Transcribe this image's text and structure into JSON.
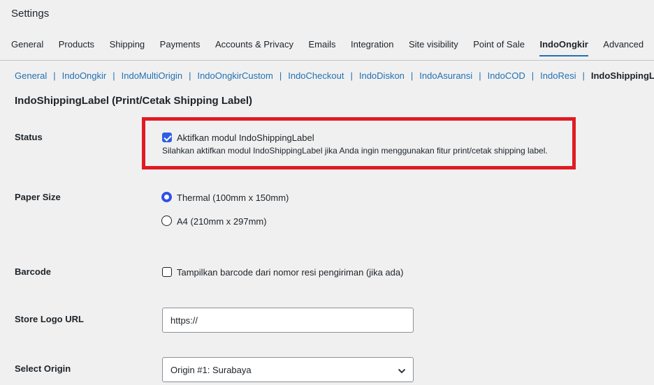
{
  "page": {
    "title": "Settings"
  },
  "tabs": [
    {
      "label": "General",
      "active": false
    },
    {
      "label": "Products",
      "active": false
    },
    {
      "label": "Shipping",
      "active": false
    },
    {
      "label": "Payments",
      "active": false
    },
    {
      "label": "Accounts & Privacy",
      "active": false
    },
    {
      "label": "Emails",
      "active": false
    },
    {
      "label": "Integration",
      "active": false
    },
    {
      "label": "Site visibility",
      "active": false
    },
    {
      "label": "Point of Sale",
      "active": false
    },
    {
      "label": "IndoOngkir",
      "active": true
    },
    {
      "label": "Advanced",
      "active": false
    }
  ],
  "subnav": {
    "separator": "|",
    "links": [
      "General",
      "IndoOngkir",
      "IndoMultiOrigin",
      "IndoOngkirCustom",
      "IndoCheckout",
      "IndoDiskon",
      "IndoAsuransi",
      "IndoCOD",
      "IndoResi"
    ],
    "current": "IndoShippingLabel"
  },
  "section": {
    "title": "IndoShippingLabel (Print/Cetak Shipping Label)"
  },
  "status": {
    "label": "Status",
    "checkbox_label": "Aktifkan modul IndoShippingLabel",
    "checked": true,
    "description": "Silahkan aktifkan modul IndoShippingLabel jika Anda ingin menggunakan fitur print/cetak shipping label."
  },
  "paper_size": {
    "label": "Paper Size",
    "options": [
      {
        "label": "Thermal (100mm x 150mm)",
        "selected": true
      },
      {
        "label": "A4 (210mm x 297mm)",
        "selected": false
      }
    ]
  },
  "barcode": {
    "label": "Barcode",
    "checkbox_label": "Tampilkan barcode dari nomor resi pengiriman (jika ada)",
    "checked": false
  },
  "store_logo": {
    "label": "Store Logo URL",
    "value": "https://"
  },
  "origin": {
    "label": "Select Origin",
    "value": "Origin #1: Surabaya"
  },
  "colors": {
    "accent": "#2271b1",
    "highlight": "#e01b24",
    "checkbox": "#2f5ee0"
  },
  "icons": {
    "select_arrow": "chevron-down-icon",
    "checkmark": "check-icon"
  }
}
